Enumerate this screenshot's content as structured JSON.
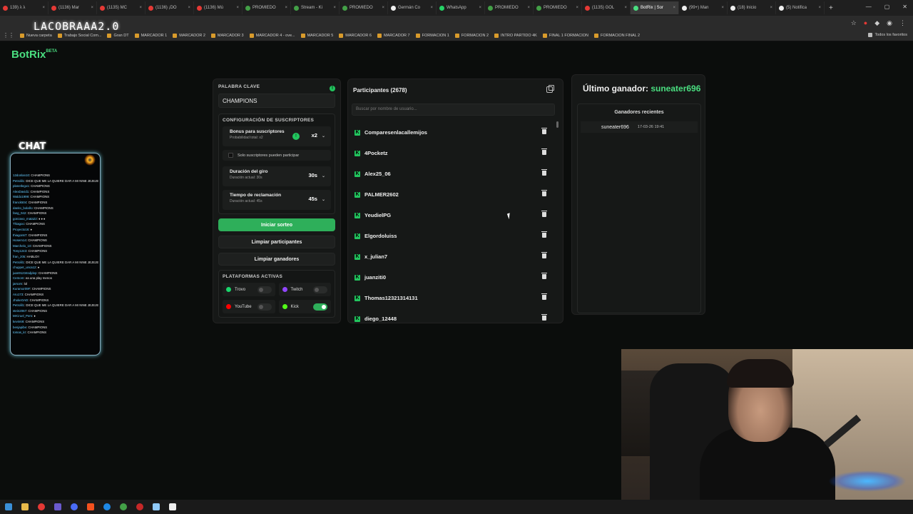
{
  "browser": {
    "tabs": [
      {
        "label": "139) λ λ",
        "icon_color": "#e53935"
      },
      {
        "label": "(1136) Mar",
        "icon_color": "#e53935"
      },
      {
        "label": "(1135) MC",
        "icon_color": "#e53935"
      },
      {
        "label": "(1136) ¡DO",
        "icon_color": "#e53935"
      },
      {
        "label": "(1136) Mú",
        "icon_color": "#e53935"
      },
      {
        "label": "PROMIEDO",
        "icon_color": "#43a047"
      },
      {
        "label": "Stream - Ki",
        "icon_color": "#43a047"
      },
      {
        "label": "PROMIEDO",
        "icon_color": "#43a047"
      },
      {
        "label": "Germán Co",
        "icon_color": "#eeeeee"
      },
      {
        "label": "WhatsApp",
        "icon_color": "#25d366"
      },
      {
        "label": "PROMIEDO",
        "icon_color": "#43a047"
      },
      {
        "label": "PROMIEDO",
        "icon_color": "#43a047"
      },
      {
        "label": "(1135) GOL",
        "icon_color": "#e53935"
      },
      {
        "label": "BotRix | Sor",
        "icon_color": "#4ade80",
        "active": true
      },
      {
        "label": "(99+) Man",
        "icon_color": "#eeeeee"
      },
      {
        "label": "(18) Inicio",
        "icon_color": "#eeeeee"
      },
      {
        "label": "(5) Notifica",
        "icon_color": "#eeeeee"
      }
    ],
    "new_tab": "+",
    "stream_overlay_title": "LACOBRAAA2.0",
    "bookmarks": [
      "Nueva carpeta",
      "Trabajo Social Com...",
      "Gran DT",
      "MARCADOR 1",
      "MARCADOR 2",
      "MARCADOR 3",
      "MARCADOR 4 - ove...",
      "MARCADOR 5",
      "MARCADOR 6",
      "MARCADOR 7",
      "FORMACION 1",
      "FORMACION 2",
      "INTRO PARTIDO 4K",
      "FINAL 1 FORMACION",
      "FORMACION FINAL 2"
    ],
    "all_bookmarks": "Todos los favoritos"
  },
  "app": {
    "logo": "BotRix",
    "logo_badge": "BETA"
  },
  "chat_overlay": {
    "title": "CHAT",
    "lines": [
      {
        "user": "12donlan10",
        "msg": ": CHAMPIONS"
      },
      {
        "user": "Petrolil1",
        "msg": ": DICE QUE ME LA QUIERE DAR A MI NINE JEJEJE"
      },
      {
        "user": "planetlego1",
        "msg": ": CHAMPIONS"
      },
      {
        "user": "AlexDavid1",
        "msg": ": CHAMPIONS"
      },
      {
        "user": "Waldo1999",
        "msg": ": CHAMPIONS"
      },
      {
        "user": "franck504",
        "msg": ": CHAMPIONS"
      },
      {
        "user": "danito_bolaño",
        "msg": ": CHAMPIONS"
      },
      {
        "user": "fang_042",
        "msg": ": CHAMPIONS"
      },
      {
        "user": "gonzavo_mata22",
        "msg": ": ♦ ♦ ♦"
      },
      {
        "user": "Thiagoo",
        "msg": ": CHAMPIONS"
      },
      {
        "user": "Proyecto16",
        "msg": ": ♦"
      },
      {
        "user": "thiagon67",
        "msg": ": CHAMPIONS"
      },
      {
        "user": "Hosem14",
        "msg": ": CHAMPIONS"
      },
      {
        "user": "Marchelo_10",
        "msg": ": CHAMPIONS"
      },
      {
        "user": "Tony1243",
        "msg": ": CHAMPIONS"
      },
      {
        "user": "fran_z05",
        "msg": ": HABLO!!"
      },
      {
        "user": "Petrolil1",
        "msg": ": DICE QUE ME LA QUIERE DAR A MI NINE JEJEJE"
      },
      {
        "user": "chuppet_unca12",
        "msg": ": ♦"
      },
      {
        "user": "juan91234sdjdep",
        "msg": ": CHAMPIONS"
      },
      {
        "user": "Cemom",
        "msg": ": ea una play menos"
      },
      {
        "user": "jarsom",
        "msg": ": lol"
      },
      {
        "user": "Kuramor09F",
        "msg": ": CHAMPIONS"
      },
      {
        "user": "Aru173",
        "msg": ": CHAMPIONS"
      },
      {
        "user": "JhokeOAD",
        "msg": ": CHAMPIONS"
      },
      {
        "user": "Petrolil1",
        "msg": ": DICE QUE ME LA QUIERE DAR A MI NINE JEJEJE"
      },
      {
        "user": "stein2067",
        "msg": ": CHAMPIONS"
      },
      {
        "user": "MrCruel_Pem",
        "msg": ": ♦"
      },
      {
        "user": "kevin69",
        "msg": ": CHAMPIONS"
      },
      {
        "user": "benjapibe",
        "msg": ": CHAMPIONS"
      },
      {
        "user": "tomas_kr",
        "msg": ": CHAMPIONS"
      }
    ]
  },
  "settings": {
    "keyword_label": "PALABRA CLAVE",
    "keyword_value": "CHAMPIONS",
    "subs_config_label": "CONFIGURACIÓN DE SUSCRIPTORES",
    "subs_bonus_title": "Bonus para suscriptores",
    "subs_bonus_sub": "Probabilidad total: x2",
    "subs_bonus_value": "x2",
    "subs_only_label": "Solo suscriptores pueden participar",
    "spin_title": "Duración del giro",
    "spin_sub": "Duración actual: 30s",
    "spin_value": "30s",
    "claim_title": "Tiempo de reclamación",
    "claim_sub": "Duración actual: 45s",
    "claim_value": "45s",
    "start_button": "Iniciar sorteo",
    "clear_participants": "Limpiar participantes",
    "clear_winners": "Limpiar ganadores",
    "platforms_label": "PLATAFORMAS ACTIVAS",
    "platforms": [
      {
        "name": "Trovo",
        "enabled": false,
        "color": "#19d66b"
      },
      {
        "name": "Twitch",
        "enabled": false,
        "color": "#9146ff"
      },
      {
        "name": "YouTube",
        "enabled": false,
        "color": "#ff0000"
      },
      {
        "name": "Kick",
        "enabled": true,
        "color": "#53fc18"
      }
    ]
  },
  "participants": {
    "title": "Participantes (2678)",
    "search_placeholder": "Buscar por nombre de usuario...",
    "items": [
      "Comparesenlacallemijos",
      "4Pocketz",
      "Alex25_06",
      "PALMER2602",
      "YeudielPG",
      "Elgordoluiss",
      "x_julian7",
      "juanziti0",
      "Thomas12321314131",
      "diego_12448"
    ]
  },
  "winners": {
    "last_winner_label": "Último ganador:",
    "last_winner_name": "suneater696",
    "recent_title": "Ganadores recientes",
    "recent": [
      {
        "name": "suneater696",
        "date": "17-03-26 19:41"
      }
    ]
  }
}
